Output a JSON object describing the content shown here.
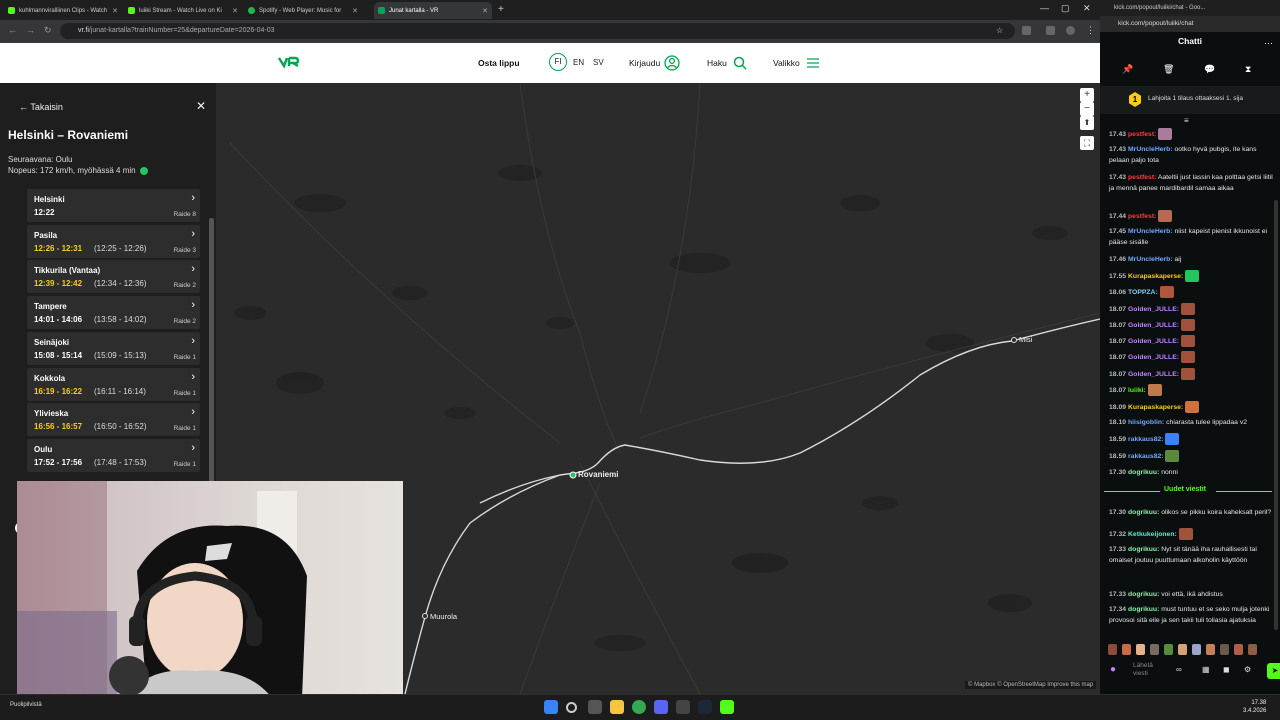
{
  "browser_tabs": [
    {
      "label": "kuhlmannviralliinen Clips - Watch",
      "color": "#53fc18"
    },
    {
      "label": "luiiki Stream - Watch Live on Ki",
      "color": "#53fc18"
    },
    {
      "label": "Spotify - Web Player: Music for",
      "color": "#1db954"
    },
    {
      "label": "Junat kartalla - VR",
      "color": "#00a651"
    }
  ],
  "address": {
    "host": "vr.fi",
    "path": "/junat-kartalla?trainNumber=25&departureDate=2026-04-03"
  },
  "vr_header": {
    "buy": "Osta lippu",
    "langs": [
      "FI",
      "EN",
      "SV"
    ],
    "login": "Kirjaudu",
    "search": "Haku",
    "menu": "Valikko"
  },
  "panel": {
    "back": "Takaisin",
    "route": "Helsinki – Rovaniemi",
    "next_station": "Seuraavana: Oulu",
    "speed": "Nopeus: 172 km/h, myöhässä 4 min",
    "stops": [
      {
        "name": "Helsinki",
        "time": "12:22",
        "orig": "",
        "track": "Raide 8",
        "late": false
      },
      {
        "name": "Pasila",
        "time": "12:26 - 12:31",
        "orig": "(12:25 - 12:26)",
        "track": "Raide 3",
        "late": true
      },
      {
        "name": "Tikkurila (Vantaa)",
        "time": "12:39 - 12:42",
        "orig": "(12:34 - 12:36)",
        "track": "Raide 2",
        "late": true
      },
      {
        "name": "Tampere",
        "time": "14:01 - 14:06",
        "orig": "(13:58 - 14:02)",
        "track": "Raide 2",
        "late": false
      },
      {
        "name": "Seinäjoki",
        "time": "15:08 - 15:14",
        "orig": "(15:09 - 15:13)",
        "track": "Raide 1",
        "late": false
      },
      {
        "name": "Kokkola",
        "time": "16:19 - 16:22",
        "orig": "(16:11 - 16:14)",
        "track": "Raide 1",
        "late": true
      },
      {
        "name": "Ylivieska",
        "time": "16:56 - 16:57",
        "orig": "(16:50 - 16:52)",
        "track": "Raide 1",
        "late": true
      },
      {
        "name": "Oulu",
        "time": "17:52 - 17:56",
        "orig": "(17:48 - 17:53)",
        "track": "Raide 1",
        "late": false
      }
    ]
  },
  "map": {
    "places": {
      "rovaniemi": "Rovaniemi",
      "misi": "Misi",
      "muurola": "Muurola"
    },
    "attribution": "© Mapbox © OpenStreetMap  Improve this map",
    "accent": "#22c55e"
  },
  "chat": {
    "window_title": "kick.com/popout/luiiki/chat - Goo...",
    "url": "kick.com/popout/luiiki/chat",
    "title": "Chatti",
    "pinned": "Lahjoita 1 tilaus ottaaksesi 1. sija",
    "pinned_rank": "1",
    "new_messages": "Uudet viestit",
    "input_placeholder": "Lähetä viesti",
    "messages": [
      {
        "time": "17.43",
        "user": "pestfest:",
        "color": "#ff3b3b",
        "text": ""
      },
      {
        "time": "17.43",
        "user": "MrUncleHerb:",
        "color": "#6fa8ff",
        "text": "ootko hyvä pubgis, ite kans pelaan paljo tota"
      },
      {
        "time": "17.43",
        "user": "pestfest:",
        "color": "#ff3b3b",
        "text": "Aateltii just lassin kaa polttaa getsi liitil ja mennä panee mardibardil samaa aikaa"
      },
      {
        "time": "17.44",
        "user": "pestfest:",
        "color": "#ff3b3b",
        "text": ""
      },
      {
        "time": "17.45",
        "user": "MrUncleHerb:",
        "color": "#6fa8ff",
        "text": "niist kapeist pienist ikkunoist ei pääse sisälle"
      },
      {
        "time": "17.46",
        "user": "MrUncleHerb:",
        "color": "#6fa8ff",
        "text": "aij"
      },
      {
        "time": "17.55",
        "user": "Kurapaskaperse:",
        "color": "#facc15",
        "text": ""
      },
      {
        "time": "18.06",
        "user": "TOPPZA:",
        "color": "#7dd3fc",
        "text": ""
      },
      {
        "time": "18.07",
        "user": "Golden_JULLE:",
        "color": "#c084fc",
        "text": ""
      },
      {
        "time": "18.07",
        "user": "Golden_JULLE:",
        "color": "#c084fc",
        "text": ""
      },
      {
        "time": "18.07",
        "user": "Golden_JULLE:",
        "color": "#c084fc",
        "text": ""
      },
      {
        "time": "18.07",
        "user": "Golden_JULLE:",
        "color": "#c084fc",
        "text": ""
      },
      {
        "time": "18.07",
        "user": "Golden_JULLE:",
        "color": "#c084fc",
        "text": ""
      },
      {
        "time": "18.07",
        "user": "luiiki:",
        "color": "#53fc18",
        "text": ""
      },
      {
        "time": "18.09",
        "user": "Kurapaskaperse:",
        "color": "#facc15",
        "text": ""
      },
      {
        "time": "18.10",
        "user": "hiisigoblin:",
        "color": "#6fa8ff",
        "text": "chiarasta tulee lippadaa v2"
      },
      {
        "time": "18.59",
        "user": "rakkaus82:",
        "color": "#6fa8ff",
        "text": ""
      },
      {
        "time": "18.59",
        "user": "rakkaus82:",
        "color": "#6fa8ff",
        "text": ""
      },
      {
        "time": "17.30",
        "user": "dogrikuu:",
        "color": "#86efac",
        "text": "nonni"
      },
      {
        "time": "17.30",
        "user": "dogrikuu:",
        "color": "#86efac",
        "text": "olikos se pikku koira kaheksalt peril?"
      },
      {
        "time": "17.32",
        "user": "Ketkukeijonen:",
        "color": "#5eead4",
        "text": ""
      },
      {
        "time": "17.33",
        "user": "dogrikuu:",
        "color": "#86efac",
        "text": "Nyt sit tänää iha rauhallisesti tai omalset joutuu puuttumaan alkoholin käyttöön"
      },
      {
        "time": "17.33",
        "user": "dogrikuu:",
        "color": "#86efac",
        "text": "voi että, ikä ahdistus"
      },
      {
        "time": "17.34",
        "user": "dogrikuu:",
        "color": "#86efac",
        "text": "must tuntuu et se seko mulja jotenki provosoi sitä eile ja sen takii tuli toliasia ajatuksia"
      }
    ]
  },
  "taskbar": {
    "weather": "Puolipilvistä",
    "time": "17.38",
    "date": "3.4.2026"
  }
}
